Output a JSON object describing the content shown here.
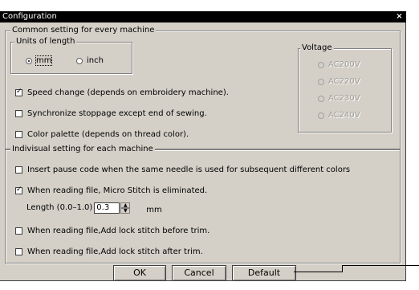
{
  "window": {
    "title": "Configuration",
    "close_glyph": "×"
  },
  "common": {
    "legend": "Common setting for every machine",
    "units": {
      "legend": "Units of length",
      "options": [
        {
          "label": "mm",
          "selected": true
        },
        {
          "label": "inch",
          "selected": false
        }
      ]
    },
    "speed_change": {
      "label": "Speed change (depends on embroidery machine).",
      "checked": true
    },
    "synchronize": {
      "label": "Synchronize stoppage except end of sewing.",
      "checked": false
    },
    "color_palette": {
      "label": "Color palette (depends on thread color).",
      "checked": false
    }
  },
  "voltage": {
    "legend": "Voltage",
    "options": [
      {
        "label": "AC200V"
      },
      {
        "label": "AC220V"
      },
      {
        "label": "AC230V"
      },
      {
        "label": "AC240V"
      }
    ]
  },
  "individual": {
    "legend": "Indivisual setting for each machine",
    "pause_code": {
      "label": "Insert pause code when the same needle is used for subsequent different colors",
      "checked": false
    },
    "micro_stitch": {
      "label": "When reading file, Micro Stitch is eliminated.",
      "checked": true
    },
    "length": {
      "label": "Length (0.0–1.0)",
      "value": "0.3",
      "unit": "mm"
    },
    "lock_before": {
      "label": "When reading file,Add lock stitch before trim.",
      "checked": false
    },
    "lock_after": {
      "label": "When reading file,Add lock stitch after trim.",
      "checked": false
    }
  },
  "buttons": {
    "ok": "OK",
    "cancel": "Cancel",
    "default": "Default"
  }
}
